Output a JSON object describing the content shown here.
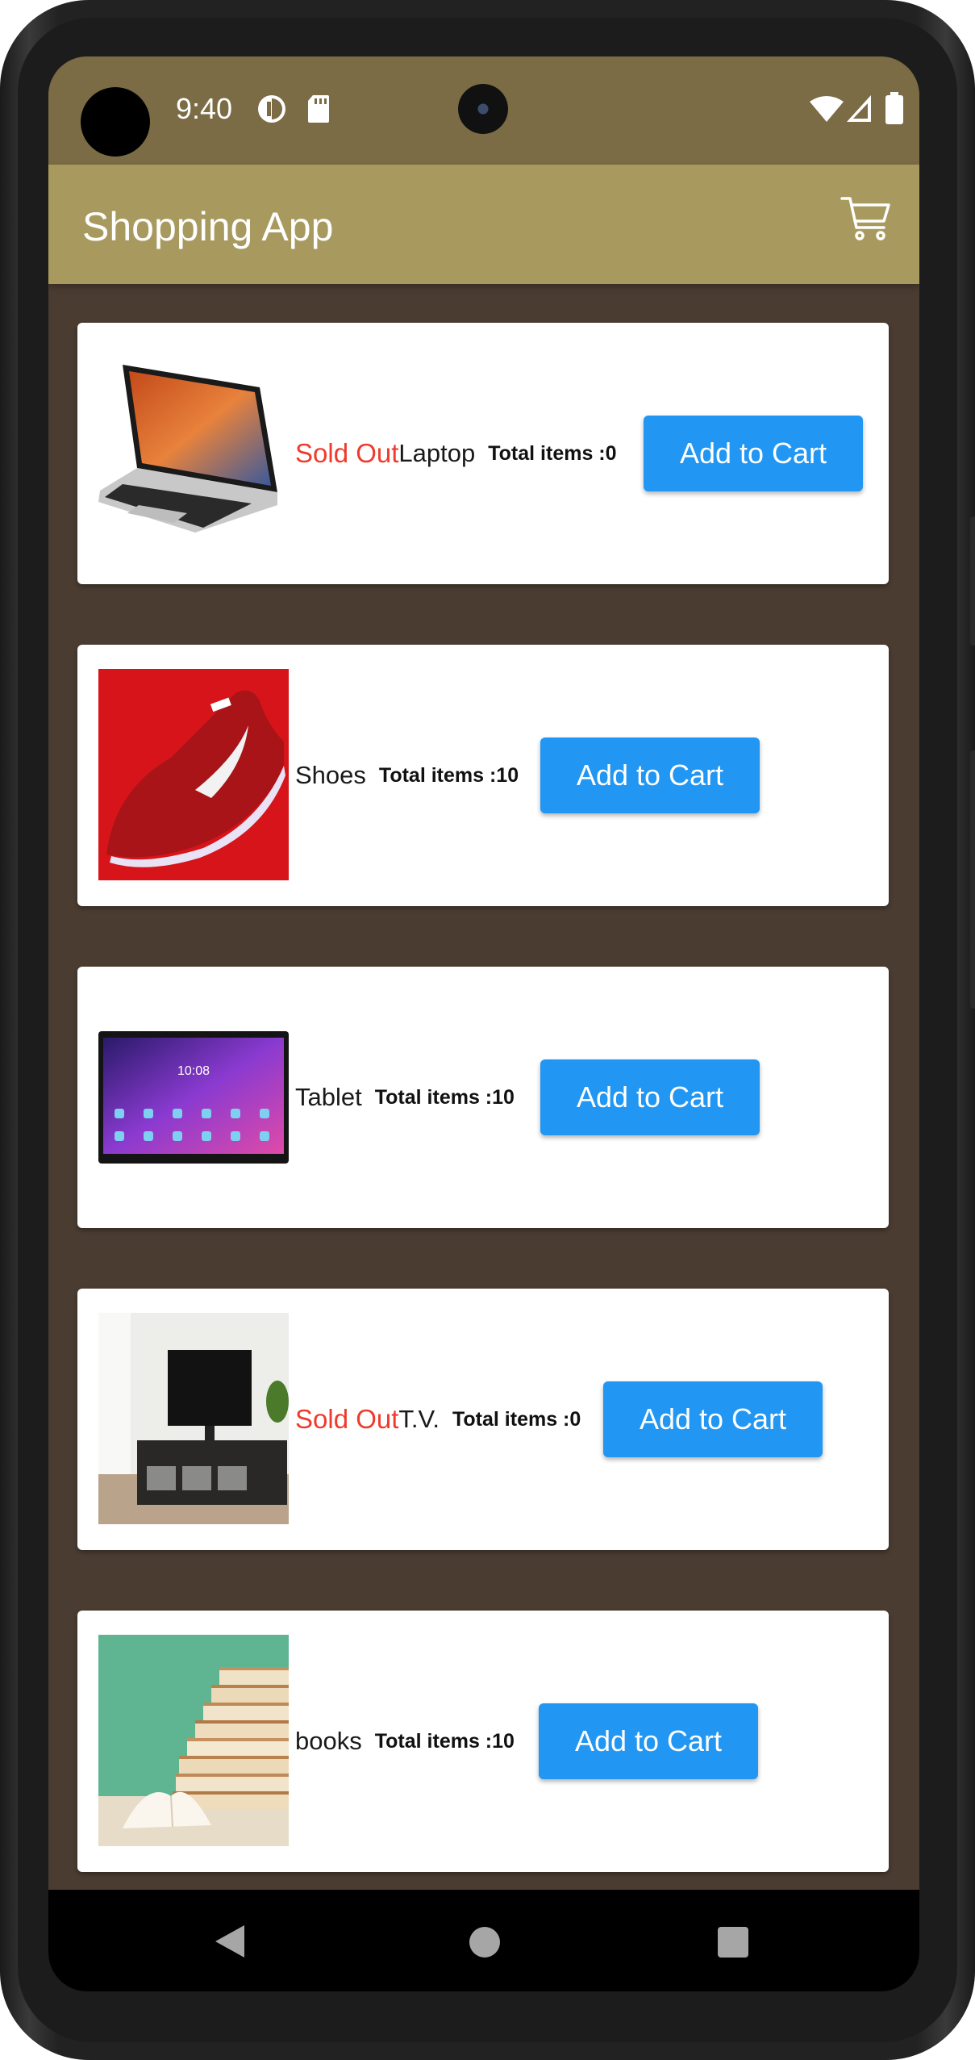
{
  "status_bar": {
    "time": "9:40"
  },
  "app_bar": {
    "title": "Shopping App"
  },
  "products": [
    {
      "name": "Laptop",
      "sold_out_label": "Sold Out",
      "total_label": "Total items :0",
      "button_label": "Add to Cart"
    },
    {
      "name": "Shoes",
      "sold_out_label": "",
      "total_label": "Total items :10",
      "button_label": "Add to Cart"
    },
    {
      "name": "Tablet",
      "sold_out_label": "",
      "total_label": "Total items :10",
      "button_label": "Add to Cart"
    },
    {
      "name": "T.V.",
      "sold_out_label": "Sold Out",
      "total_label": "Total items :0",
      "button_label": "Add to Cart"
    },
    {
      "name": "books",
      "sold_out_label": "",
      "total_label": "Total items :10",
      "button_label": "Add to Cart"
    }
  ],
  "colors": {
    "status_bar": "#7b6c45",
    "app_bar": "#a89a5f",
    "background": "#4a3c31",
    "button": "#2196f3",
    "sold_out": "#ef3b2c"
  },
  "icons": {
    "cart": "shopping-cart-icon",
    "wifi": "wifi-icon",
    "signal": "signal-icon",
    "battery": "battery-icon"
  }
}
